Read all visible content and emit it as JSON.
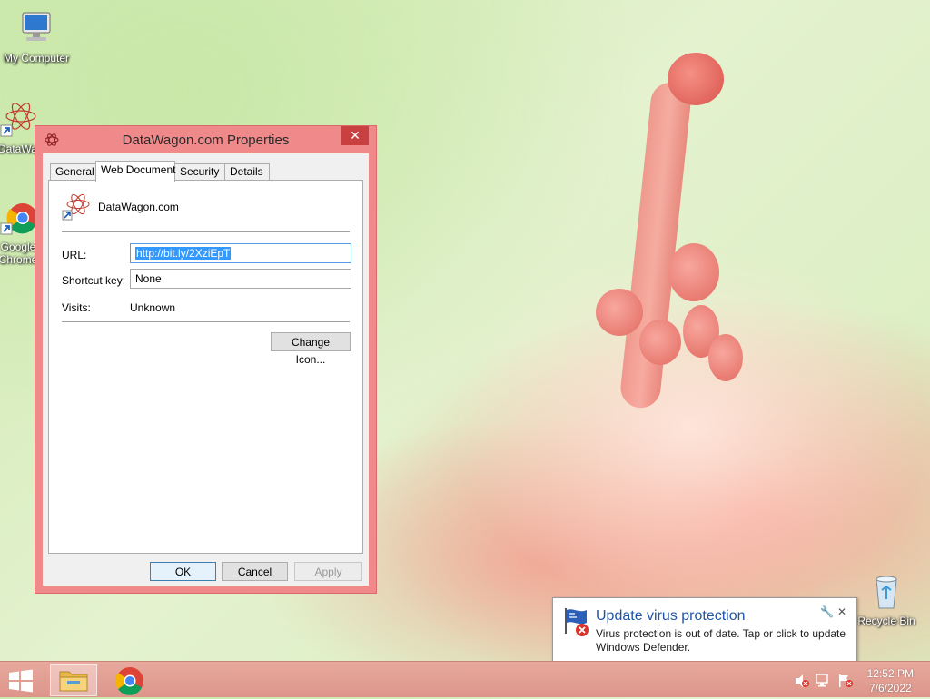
{
  "desktop": {
    "icons": [
      {
        "label": "My Computer",
        "icon": "computer-icon"
      },
      {
        "label": "DataWagon.com",
        "icon": "internet-shortcut-icon"
      },
      {
        "label": "Google Chrome",
        "icon": "chrome-icon"
      },
      {
        "label": "Recycle Bin",
        "icon": "recycle-bin-icon"
      }
    ]
  },
  "window": {
    "title": "DataWagon.com Properties",
    "close_glyph": "✕",
    "tabs": [
      {
        "label": "General",
        "active": false
      },
      {
        "label": "Web Document",
        "active": true
      },
      {
        "label": "Security",
        "active": false
      },
      {
        "label": "Details",
        "active": false
      }
    ],
    "shortcut_name": "DataWagon.com",
    "url_label": "URL:",
    "url_value": "http://bit.ly/2XziEpT",
    "shortcut_key_label": "Shortcut key:",
    "shortcut_key_value": "None",
    "visits_label": "Visits:",
    "visits_value": "Unknown",
    "change_icon_button": "Change Icon...",
    "ok_button": "OK",
    "cancel_button": "Cancel",
    "apply_button": "Apply"
  },
  "notification": {
    "title": "Update virus protection",
    "body": "Virus protection is out of date. Tap or click to update Windows Defender.",
    "icon": "windows-defender-flag-icon"
  },
  "taskbar": {
    "items": [
      {
        "name": "start-button",
        "icon": "windows-logo-icon"
      },
      {
        "name": "file-explorer",
        "icon": "folder-icon",
        "active": true
      },
      {
        "name": "google-chrome",
        "icon": "chrome-icon",
        "active": false
      }
    ],
    "tray": [
      "volume-muted-icon",
      "network-icon",
      "action-center-flag-icon"
    ],
    "clock_time": "12:52 PM",
    "clock_date": "7/6/2022"
  },
  "colors": {
    "window_frame": "#f0898a",
    "close_button": "#c94040",
    "selection": "#3399ff",
    "notification_title": "#1f55a4",
    "taskbar": "#dd958a"
  }
}
